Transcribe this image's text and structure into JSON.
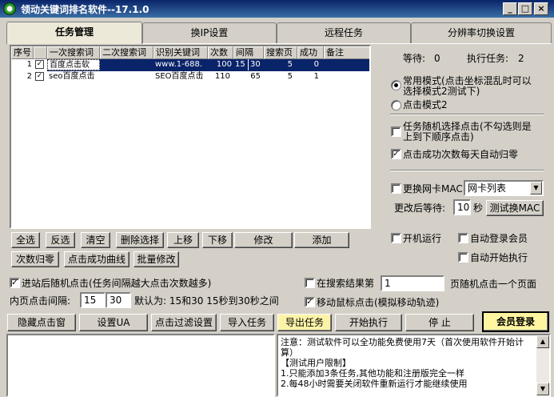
{
  "window": {
    "title": "领动关键词排名软件--17.1.0",
    "minimize": "_",
    "maximize": "□",
    "close": "×"
  },
  "tabs": [
    "任务管理",
    "换IP设置",
    "远程任务",
    "分辨率切换设置"
  ],
  "table": {
    "headers": [
      "序号",
      "一次搜索词",
      "二次搜索词",
      "识别关键词",
      "次数",
      "间隔",
      "搜索页",
      "成功",
      "备注"
    ],
    "rows": [
      {
        "no": "1",
        "checked": "✓",
        "kw1": "百度点击软",
        "kw2": "",
        "kw3": "www.1-688.",
        "count": "100",
        "interval_a": "15",
        "interval_b": "30",
        "page": "5",
        "success": "0",
        "note": ""
      },
      {
        "no": "2",
        "checked": "✓",
        "kw1": "seo百度点击",
        "kw2": "",
        "kw3": "SEO百度点击",
        "count": "110",
        "interval": "65",
        "page": "5",
        "success": "1",
        "note": ""
      }
    ]
  },
  "status": {
    "waiting_label": "等待:",
    "waiting": "0",
    "running_label": "执行任务:",
    "running": "2"
  },
  "modes": {
    "mode1": "常用模式(点击坐标混乱时可以选择模式2测试下)",
    "mode2": "点击模式2"
  },
  "options": {
    "random_click": "任务随机选择点击(不勾选则是上到下顺序点击)",
    "auto_reset": "点击成功次数每天自动归零",
    "change_mac": "更换网卡MAC",
    "mac_list": "网卡列表",
    "wait_after_label": "更改后等待:",
    "wait_after_value": "10",
    "wait_after_unit": "秒",
    "test_mac": "测试换MAC",
    "boot_run": "开机运行",
    "auto_login": "自动登录会员",
    "auto_start": "自动开始执行"
  },
  "task_buttons": [
    "全选",
    "反选",
    "清空",
    "删除选择",
    "上移",
    "下移",
    "修改",
    "添加",
    "次数归零",
    "点击成功曲线",
    "批量修改"
  ],
  "settings": {
    "random_after_enter": "进站后随机点击(任务间隔越大点击次数越多)",
    "inner_interval_label": "内页点击间隔:",
    "inner_a": "15",
    "inner_b": "30",
    "default_text": "默认为: 15和30  15秒到30秒之间",
    "in_results_label": "在搜索结果第",
    "in_results_value": "1",
    "in_results_suffix": "页随机点击一个页面",
    "move_mouse": "移动鼠标点击(模拟移动轨迹)"
  },
  "bottom_buttons": [
    "隐藏点击窗",
    "设置UA",
    "点击过滤设置",
    "导入任务",
    "导出任务",
    "开始执行",
    "停 止",
    "会员登录"
  ],
  "notice": {
    "line1": "注意：测试软件可以全功能免费使用7天（首次使用软件开始计算）",
    "line2": "【测试用户限制】",
    "line3": "1.只能添加3条任务,其他功能和注册版完全一样",
    "line4": "2.每48小时需要关闭软件重新运行才能继续使用"
  }
}
